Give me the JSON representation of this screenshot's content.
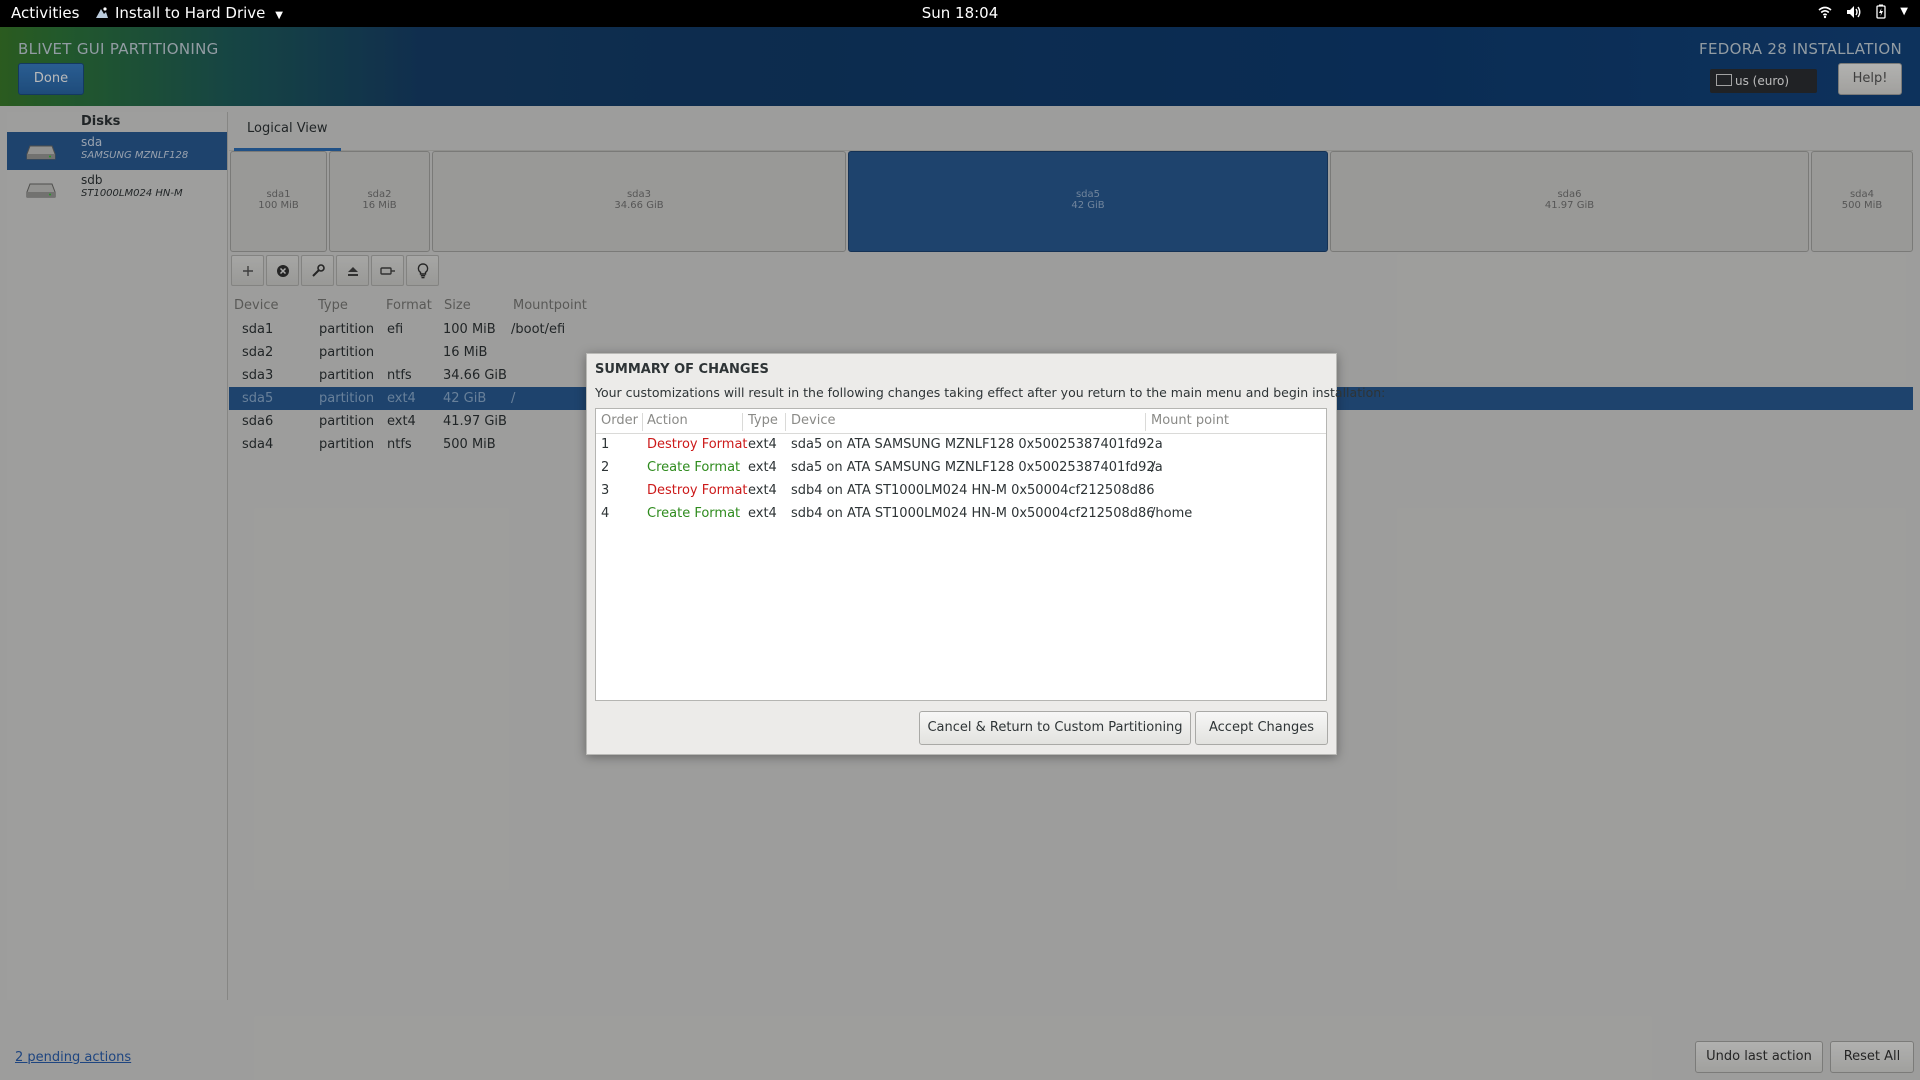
{
  "topbar": {
    "activities": "Activities",
    "app_menu": "Install to Hard Drive",
    "clock": "Sun 18:04",
    "tray_icons": [
      "wifi-icon",
      "volume-icon",
      "battery-icon",
      "chevron-down-icon"
    ]
  },
  "header": {
    "spoke_title": "BLIVET GUI PARTITIONING",
    "done_label": "Done",
    "product_title": "FEDORA 28 INSTALLATION",
    "keyboard_layout": "us (euro)",
    "help_label": "Help!"
  },
  "disks": {
    "header": "Disks",
    "items": [
      {
        "name": "sda",
        "model": "SAMSUNG MZNLF128",
        "selected": true
      },
      {
        "name": "sdb",
        "model": "ST1000LM024 HN-M",
        "selected": false
      }
    ]
  },
  "tabs": {
    "logical_view": "Logical View"
  },
  "disk_map": [
    {
      "name": "sda1",
      "size": "100 MiB"
    },
    {
      "name": "sda2",
      "size": "16 MiB"
    },
    {
      "name": "sda3",
      "size": "34.66 GiB"
    },
    {
      "name": "sda5",
      "size": "42 GiB",
      "selected": true
    },
    {
      "name": "sda6",
      "size": "41.97 GiB"
    },
    {
      "name": "sda4",
      "size": "500 MiB"
    }
  ],
  "toolbar_icons": [
    "add-icon",
    "delete-icon",
    "edit-icon",
    "unmount-icon",
    "resize-icon",
    "info-icon"
  ],
  "device_table": {
    "headers": {
      "device": "Device",
      "type": "Type",
      "format": "Format",
      "size": "Size",
      "mountpoint": "Mountpoint"
    },
    "rows": [
      {
        "device": "sda1",
        "type": "partition",
        "format": "efi",
        "size": "100 MiB",
        "mountpoint": "/boot/efi"
      },
      {
        "device": "sda2",
        "type": "partition",
        "format": "",
        "size": "16 MiB",
        "mountpoint": ""
      },
      {
        "device": "sda3",
        "type": "partition",
        "format": "ntfs",
        "size": "34.66 GiB",
        "mountpoint": ""
      },
      {
        "device": "sda5",
        "type": "partition",
        "format": "ext4",
        "size": "42 GiB",
        "mountpoint": "/"
      },
      {
        "device": "sda6",
        "type": "partition",
        "format": "ext4",
        "size": "41.97 GiB",
        "mountpoint": ""
      },
      {
        "device": "sda4",
        "type": "partition",
        "format": "ntfs",
        "size": "500 MiB",
        "mountpoint": ""
      }
    ]
  },
  "bottom": {
    "pending_link": "2 pending actions",
    "undo_label": "Undo last action",
    "reset_label": "Reset All"
  },
  "dialog": {
    "title": "SUMMARY OF CHANGES",
    "message": "Your customizations will result in the following changes taking effect after you return to the main menu and begin installation:",
    "headers": {
      "order": "Order",
      "action": "Action",
      "type": "Type",
      "device": "Device",
      "mount_point": "Mount point"
    },
    "rows": [
      {
        "order": "1",
        "action": "Destroy Format",
        "type": "ext4",
        "device": "sda5 on ATA SAMSUNG MZNLF128 0x50025387401fd92a",
        "mount_point": ""
      },
      {
        "order": "2",
        "action": "Create Format",
        "type": "ext4",
        "device": "sda5 on ATA SAMSUNG MZNLF128 0x50025387401fd92a",
        "mount_point": "/"
      },
      {
        "order": "3",
        "action": "Destroy Format",
        "type": "ext4",
        "device": "sdb4 on ATA ST1000LM024 HN-M 0x50004cf212508d86",
        "mount_point": ""
      },
      {
        "order": "4",
        "action": "Create Format",
        "type": "ext4",
        "device": "sdb4 on ATA ST1000LM024 HN-M 0x50004cf212508d86",
        "mount_point": "/home"
      }
    ],
    "cancel_label": "Cancel & Return to Custom Partitioning",
    "accept_label": "Accept Changes"
  },
  "colors": {
    "accent": "#2a5d96",
    "destroy": "#cc1a1a",
    "create": "#2e8b1d"
  }
}
